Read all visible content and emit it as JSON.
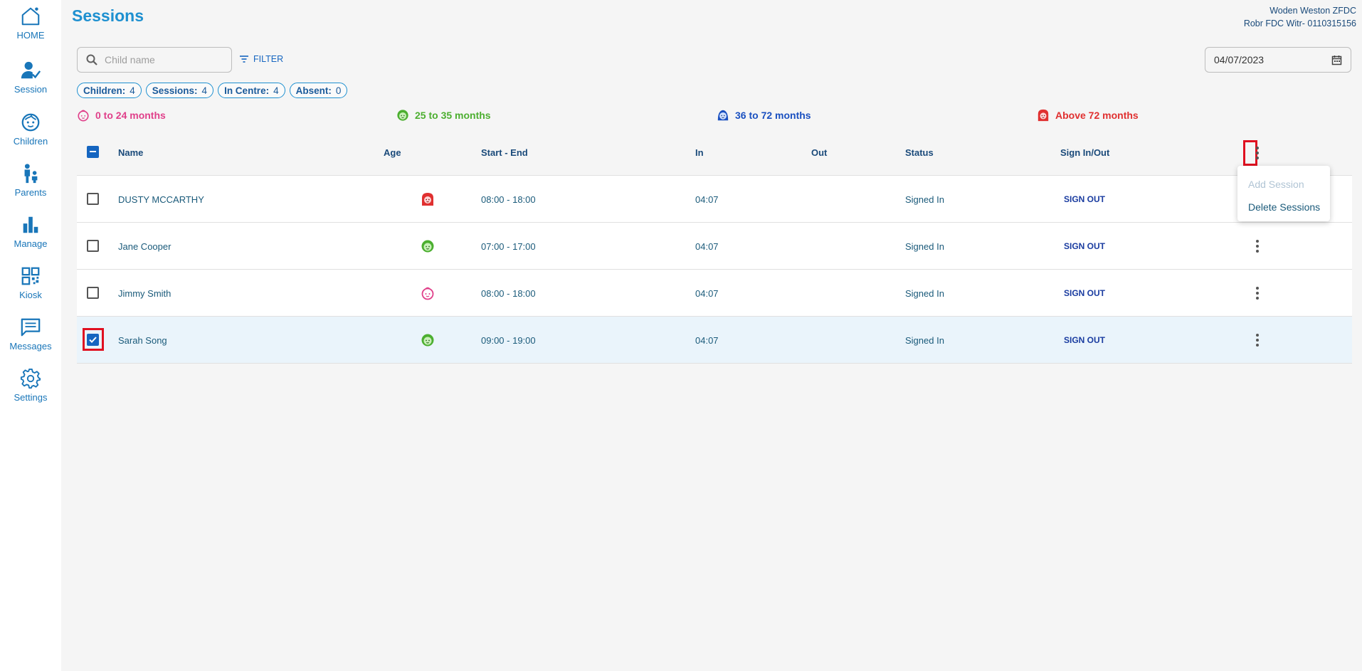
{
  "sidebar": {
    "items": [
      {
        "label": "HOME",
        "icon": "home-icon"
      },
      {
        "label": "Session",
        "icon": "session-icon"
      },
      {
        "label": "Children",
        "icon": "child-face-icon"
      },
      {
        "label": "Parents",
        "icon": "parent-child-icon"
      },
      {
        "label": "Manage",
        "icon": "bar-chart-icon"
      },
      {
        "label": "Kiosk",
        "icon": "qr-code-icon"
      },
      {
        "label": "Messages",
        "icon": "message-icon"
      },
      {
        "label": "Settings",
        "icon": "gear-icon"
      }
    ]
  },
  "header": {
    "title": "Sessions",
    "org_line1": "Woden Weston ZFDC",
    "org_line2": "Robr FDC Witr- 0110315156"
  },
  "search": {
    "placeholder": "Child name",
    "value": ""
  },
  "filter_label": "FILTER",
  "date": "04/07/2023",
  "chips": [
    {
      "label": "Children:",
      "value": "4"
    },
    {
      "label": "Sessions:",
      "value": "4"
    },
    {
      "label": "In Centre:",
      "value": "4"
    },
    {
      "label": "Absent:",
      "value": "0"
    }
  ],
  "age_legend": [
    {
      "label": "0 to 24 months",
      "color": "#e0408a",
      "icon": "infant-icon"
    },
    {
      "label": "25 to 35 months",
      "color": "#4caf30",
      "icon": "toddler-icon"
    },
    {
      "label": "36 to 72 months",
      "color": "#1a50c0",
      "icon": "preschooler-icon"
    },
    {
      "label": "Above 72 months",
      "color": "#e03030",
      "icon": "school-age-icon"
    }
  ],
  "table": {
    "headers": {
      "name": "Name",
      "age": "Age",
      "start_end": "Start - End",
      "in": "In",
      "out": "Out",
      "status": "Status",
      "sign": "Sign In/Out"
    },
    "rows": [
      {
        "name": "DUSTY MCCARTHY",
        "age_group": "Above 72 months",
        "start_end": "08:00 - 18:00",
        "in": "04:07",
        "out": "",
        "status": "Signed In",
        "action": "SIGN OUT",
        "checked": false
      },
      {
        "name": "Jane Cooper",
        "age_group": "25 to 35 months",
        "start_end": "07:00 - 17:00",
        "in": "04:07",
        "out": "",
        "status": "Signed In",
        "action": "SIGN OUT",
        "checked": false
      },
      {
        "name": "Jimmy Smith",
        "age_group": "0 to 24 months",
        "start_end": "08:00 - 18:00",
        "in": "04:07",
        "out": "",
        "status": "Signed In",
        "action": "SIGN OUT",
        "checked": false
      },
      {
        "name": "Sarah Song",
        "age_group": "25 to 35 months",
        "start_end": "09:00 - 19:00",
        "in": "04:07",
        "out": "",
        "status": "Signed In",
        "action": "SIGN OUT",
        "checked": true
      }
    ]
  },
  "menu": {
    "items": [
      {
        "label": "Add Session",
        "disabled": true
      },
      {
        "label": "Delete Sessions",
        "disabled": false
      }
    ]
  },
  "colors": {
    "accent": "#1e90d0",
    "highlight": "#e01020",
    "selected_row": "#eaf4fb"
  }
}
